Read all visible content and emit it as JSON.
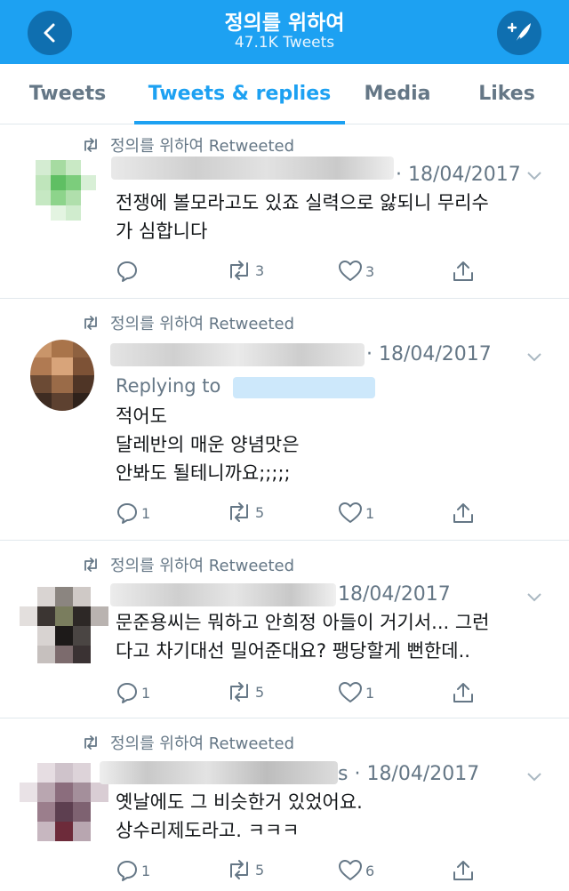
{
  "header": {
    "title": "정의를 위하여",
    "subtitle": "47.1K Tweets"
  },
  "tabs": [
    "Tweets",
    "Tweets & replies",
    "Media",
    "Likes"
  ],
  "tweets": [
    {
      "retweet_label": "정의를 위하여 Retweeted",
      "date": "· 18/04/2017",
      "text": "전쟁에 볼모라고도 있죠 실력으로 앓되니 무리수\n가 심합니다",
      "reply_count": "",
      "retweet_count": "3",
      "like_count": "3"
    },
    {
      "retweet_label": "정의를 위하여 Retweeted",
      "date": "· 18/04/2017",
      "reply_to": "Replying to",
      "text": "적어도\n달레반의 매운 양념맛은\n안봐도 될테니까요;;;;;",
      "reply_count": "1",
      "retweet_count": "5",
      "like_count": "1"
    },
    {
      "retweet_label": "정의를 위하여 Retweeted",
      "date": "18/04/2017",
      "text": "문준용씨는 뭐하고 안희정 아들이 거기서... 그런\n다고 차기대선 밀어준대요? 팽당할게 뻔한데..",
      "reply_count": "1",
      "retweet_count": "5",
      "like_count": "1"
    },
    {
      "retweet_label": "정의를 위하여 Retweeted",
      "date": "s · 18/04/2017",
      "text": "옛날에도 그 비슷한거 있었어요.\n상수리제도라고. ㅋㅋㅋ",
      "reply_count": "1",
      "retweet_count": "5",
      "like_count": "6"
    }
  ],
  "colors": {
    "brand": "#1da1f2",
    "secondary_text": "#657786",
    "divider": "#e1e8ed"
  }
}
